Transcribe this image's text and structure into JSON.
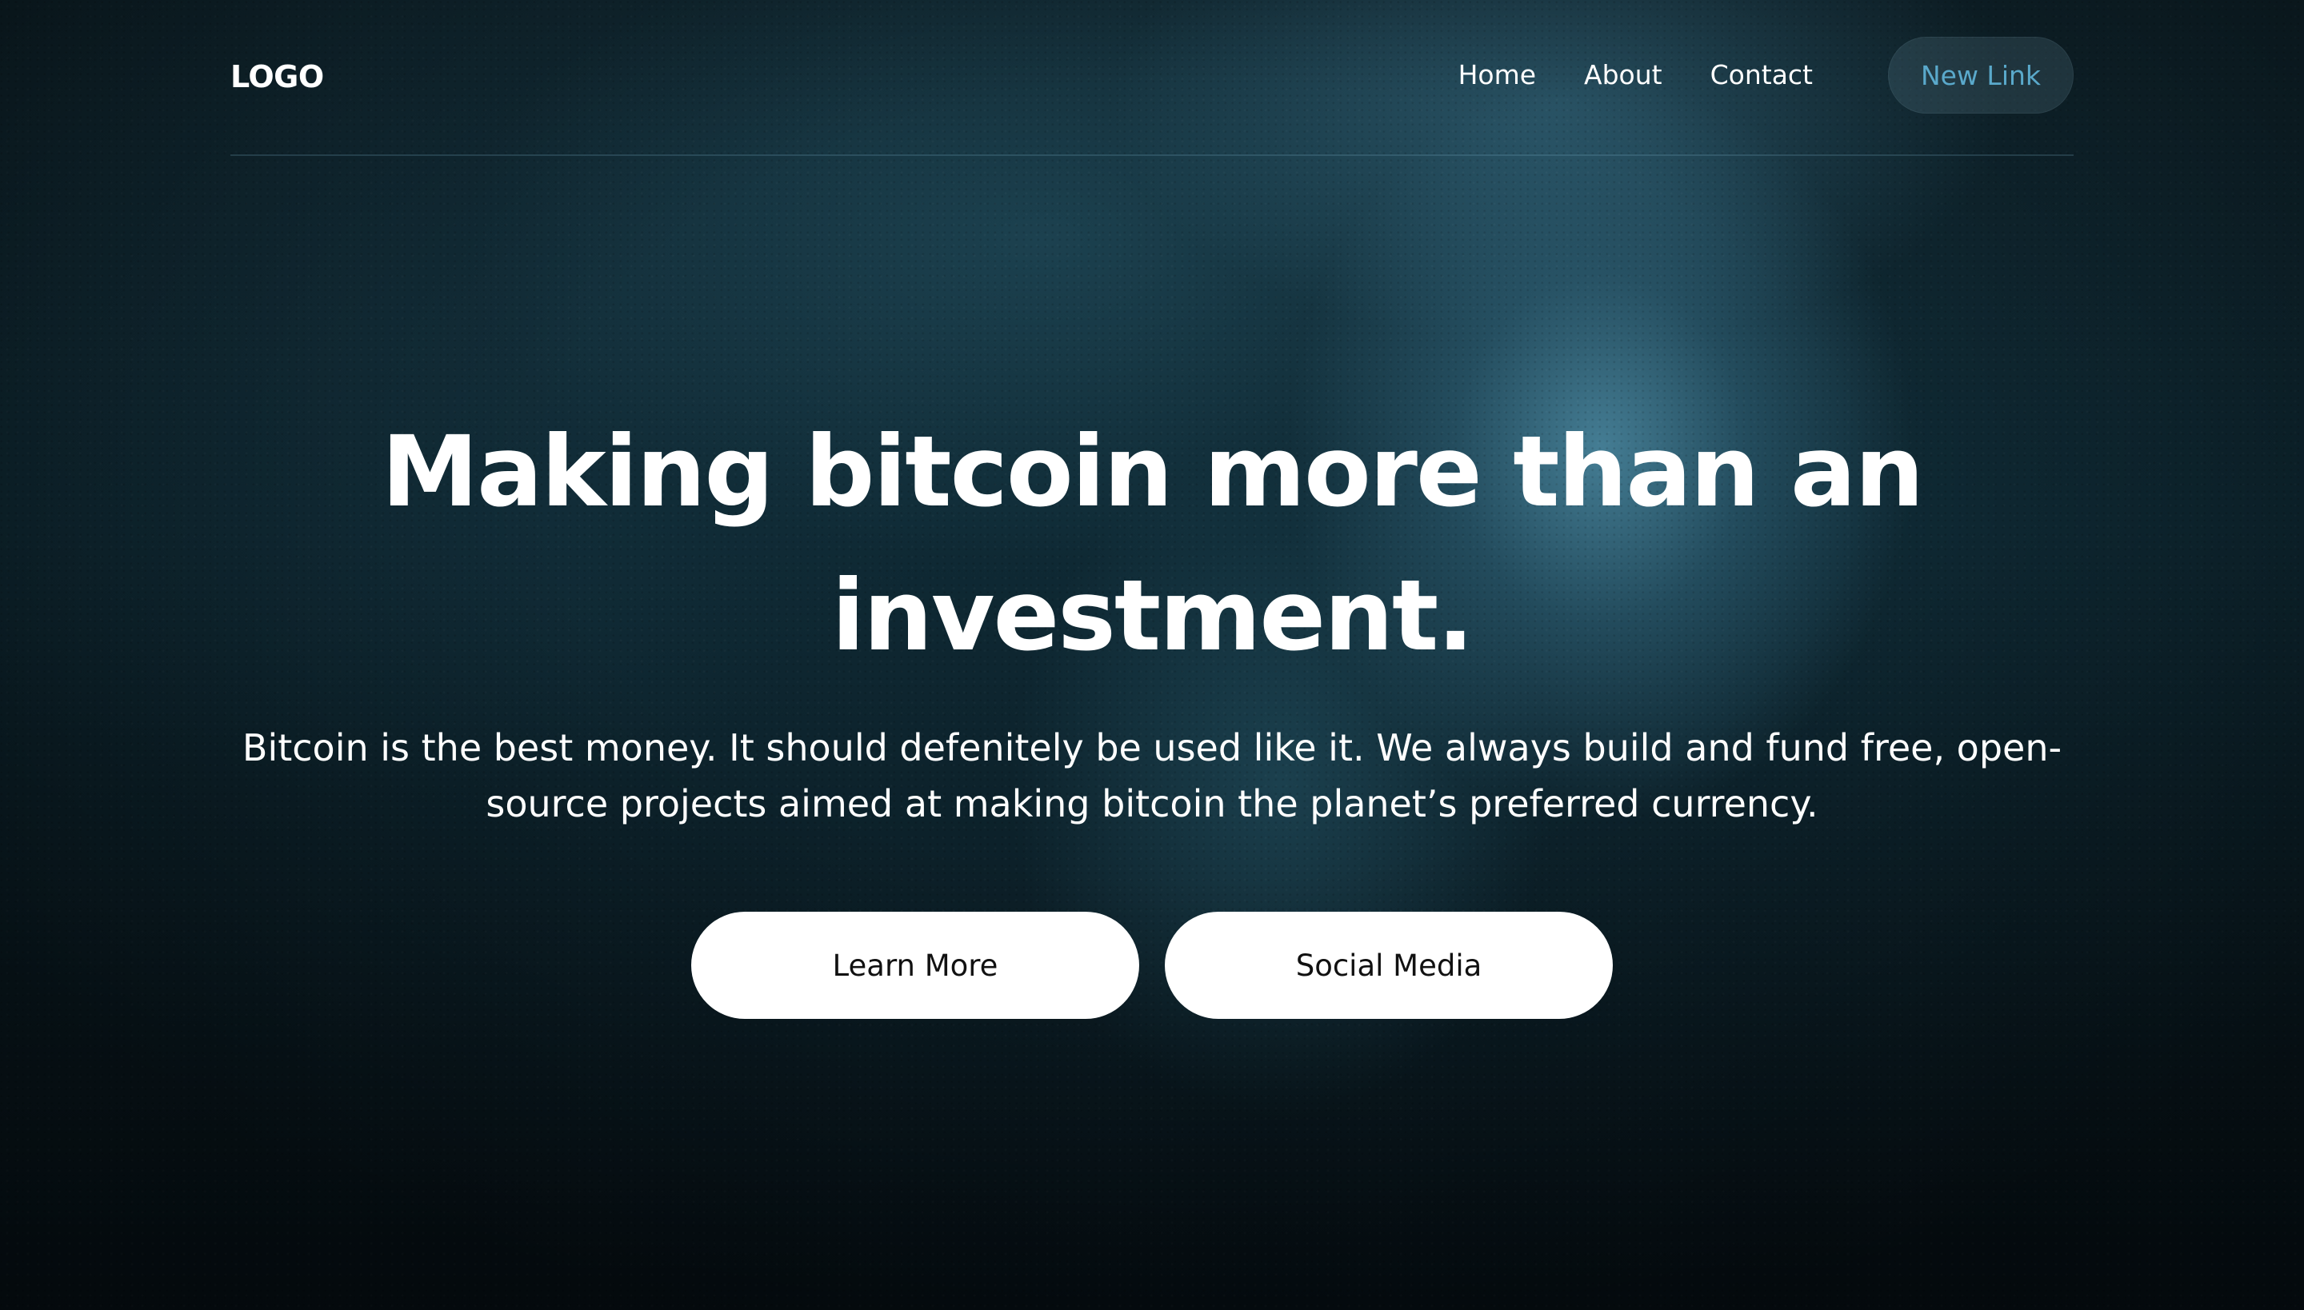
{
  "navbar": {
    "logo": "LOGO",
    "links": [
      {
        "label": "Home"
      },
      {
        "label": "About"
      },
      {
        "label": "Contact"
      }
    ],
    "cta_label": "New Link"
  },
  "hero": {
    "title": "Making bitcoin more than an investment.",
    "subtitle": "Bitcoin is the best money. It should defenitely be used like it. We always build and fund free, open-source projects aimed at making bitcoin the planet’s preferred currency.",
    "buttons": {
      "primary": "Learn More",
      "secondary": "Social Media"
    }
  },
  "colors": {
    "background": "#0f2a35",
    "accent_link": "#5aa9cb",
    "button_bg": "#ffffff",
    "button_text": "#111111"
  }
}
